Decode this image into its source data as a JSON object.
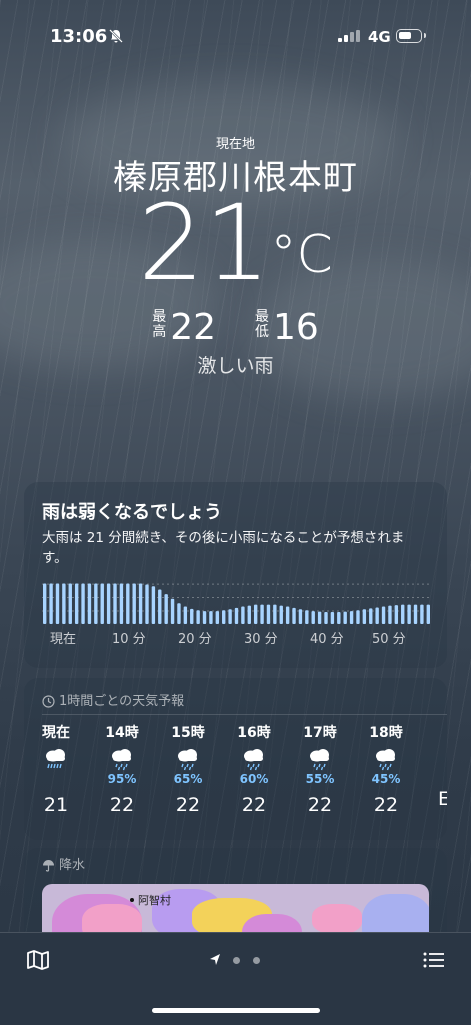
{
  "status": {
    "time": "13:06",
    "network": "4G"
  },
  "header": {
    "location_label": "現在地",
    "city": "榛原郡川根本町",
    "temperature": "21",
    "degree_unit": "°C",
    "high_label": "最高",
    "high": "22",
    "low_label": "最低",
    "low": "16",
    "condition": "激しい雨"
  },
  "minute_forecast": {
    "title": "雨は弱くなるでしょう",
    "description": "大雨は 21 分間続き、その後に小雨になることが予想されます。",
    "ticks": [
      "現在",
      "10 分",
      "20 分",
      "30 分",
      "40 分",
      "50 分"
    ],
    "intensity": [
      0.88,
      0.88,
      0.88,
      0.88,
      0.88,
      0.88,
      0.88,
      0.88,
      0.88,
      0.88,
      0.88,
      0.88,
      0.88,
      0.88,
      0.88,
      0.88,
      0.86,
      0.82,
      0.75,
      0.65,
      0.55,
      0.45,
      0.38,
      0.33,
      0.3,
      0.28,
      0.28,
      0.28,
      0.3,
      0.32,
      0.35,
      0.38,
      0.4,
      0.42,
      0.42,
      0.42,
      0.42,
      0.4,
      0.38,
      0.35,
      0.32,
      0.3,
      0.28,
      0.27,
      0.26,
      0.26,
      0.26,
      0.27,
      0.28,
      0.3,
      0.32,
      0.34,
      0.36,
      0.38,
      0.4,
      0.41,
      0.42,
      0.42,
      0.42,
      0.42,
      0.42
    ]
  },
  "hourly": {
    "label": "1時間ごとの天気予報",
    "items": [
      {
        "hour": "現在",
        "pct": "",
        "temp": "21",
        "icon": "heavy-rain-icon"
      },
      {
        "hour": "14時",
        "pct": "95%",
        "temp": "22",
        "icon": "rain-icon"
      },
      {
        "hour": "15時",
        "pct": "65%",
        "temp": "22",
        "icon": "rain-icon"
      },
      {
        "hour": "16時",
        "pct": "60%",
        "temp": "22",
        "icon": "rain-icon"
      },
      {
        "hour": "17時",
        "pct": "55%",
        "temp": "22",
        "icon": "rain-icon"
      },
      {
        "hour": "18時",
        "pct": "45%",
        "temp": "22",
        "icon": "rain-icon"
      }
    ],
    "peek_temp": "E"
  },
  "precip": {
    "label": "降水",
    "map_place": "阿智村"
  },
  "colors": {
    "accent_pct": "#7fc4ff",
    "bar": "#a8d4ff"
  }
}
